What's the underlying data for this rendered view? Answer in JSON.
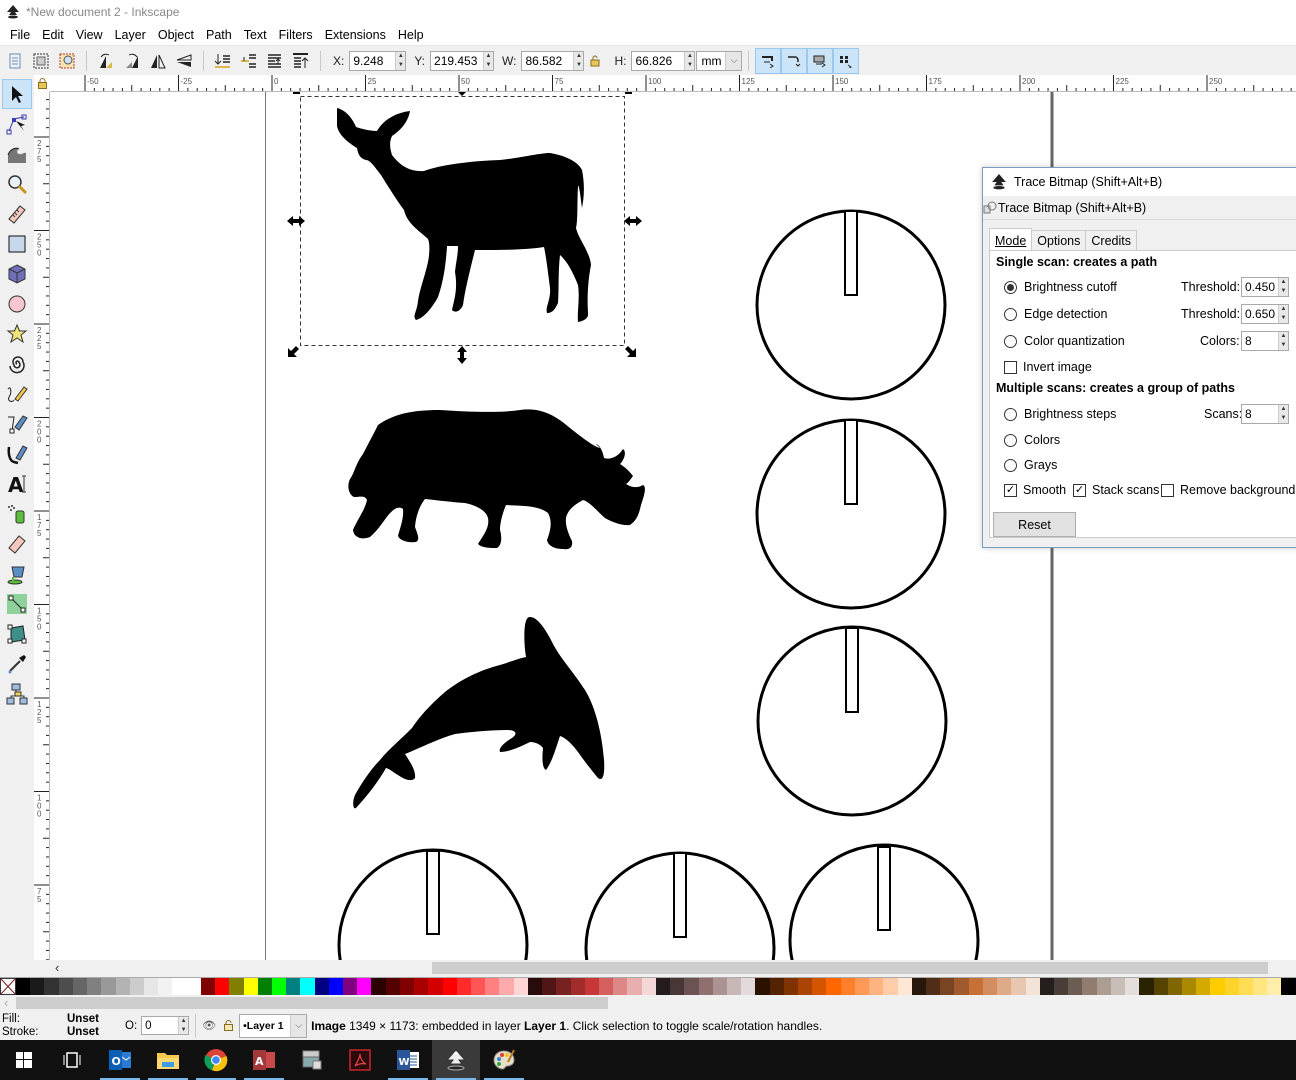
{
  "window": {
    "title": "*New document 2 - Inkscape"
  },
  "menu": [
    "File",
    "Edit",
    "View",
    "Layer",
    "Object",
    "Path",
    "Text",
    "Filters",
    "Extensions",
    "Help"
  ],
  "toolbar": {
    "x_label": "X:",
    "x_value": "9.248",
    "y_label": "Y:",
    "y_value": "219.453",
    "w_label": "W:",
    "w_value": "86.582",
    "h_label": "H:",
    "h_value": "66.826",
    "unit": "mm"
  },
  "rulers": {
    "horizontal": [
      "-50",
      "-25",
      "0",
      "25",
      "50",
      "75",
      "100",
      "125",
      "150",
      "175",
      "200",
      "225",
      "250"
    ],
    "vertical": [
      "275",
      "250",
      "225",
      "200",
      "175",
      "150",
      "125",
      "100",
      "75"
    ]
  },
  "tools": [
    "selector",
    "node",
    "tweak",
    "zoom",
    "measure",
    "rectangle",
    "3d-box",
    "ellipse",
    "star",
    "spiral",
    "pencil",
    "pen",
    "calligraphy",
    "text",
    "spray",
    "eraser",
    "paint-bucket",
    "gradient",
    "mesh",
    "dropper",
    "connector"
  ],
  "canvas": {
    "objects": [
      "deer-silhouette",
      "rhino-silhouette",
      "dolphin-silhouette",
      "dial-circle",
      "dial-circle",
      "dial-circle",
      "dial-circle",
      "dial-circle",
      "dial-circle"
    ]
  },
  "dialog": {
    "title": "Trace Bitmap (Shift+Alt+B)",
    "subtitle": "Trace Bitmap (Shift+Alt+B)",
    "tabs": [
      "Mode",
      "Options",
      "Credits"
    ],
    "active_tab": "Mode",
    "single_heading": "Single scan: creates a path",
    "brightness_label": "Brightness cutoff",
    "brightness_threshold_label": "Threshold:",
    "brightness_threshold": "0.450",
    "edge_label": "Edge detection",
    "edge_threshold_label": "Threshold:",
    "edge_threshold": "0.650",
    "color_q_label": "Color quantization",
    "colors_label": "Colors:",
    "colors_value": "8",
    "invert_label": "Invert image",
    "multi_heading": "Multiple scans: creates a group of paths",
    "bsteps_label": "Brightness steps",
    "scans_label": "Scans:",
    "scans_value": "8",
    "colors_opt_label": "Colors",
    "grays_label": "Grays",
    "smooth_label": "Smooth",
    "stack_label": "Stack scans",
    "remove_bg_label": "Remove background",
    "reset_label": "Reset",
    "selected_mode": "Brightness cutoff",
    "smooth_checked": true,
    "stack_checked": true,
    "invert_checked": false,
    "remove_bg_checked": false
  },
  "palette": [
    "none",
    "#000000",
    "#1a1a1a",
    "#333333",
    "#4d4d4d",
    "#666666",
    "#808080",
    "#999999",
    "#b3b3b3",
    "#cccccc",
    "#e6e6e6",
    "#f2f2f2",
    "#ffffff",
    "#ffffff",
    "#800000",
    "#ff0000",
    "#808000",
    "#ffff00",
    "#008000",
    "#00ff00",
    "#008080",
    "#00ffff",
    "#000080",
    "#0000ff",
    "#800080",
    "#ff00ff",
    "#2b0000",
    "#550000",
    "#800000",
    "#aa0000",
    "#d40000",
    "#ff0000",
    "#ff2a2a",
    "#ff5555",
    "#ff8080",
    "#ffaaaa",
    "#ffd5d5",
    "#280b0b",
    "#501616",
    "#782121",
    "#a02c2c",
    "#c83737",
    "#d35f5f",
    "#de8787",
    "#e9afaf",
    "#f4d7d7",
    "#241c1c",
    "#483737",
    "#6c5353",
    "#916f6f",
    "#ac9393",
    "#c8b7b7",
    "#e3dbdb",
    "#2b1100",
    "#552200",
    "#803300",
    "#aa4400",
    "#d45500",
    "#ff6600",
    "#ff7f2a",
    "#ff9955",
    "#ffb380",
    "#ffccaa",
    "#ffe6d5",
    "#28170b",
    "#502d16",
    "#784421",
    "#a05a2c",
    "#c87137",
    "#d38d5f",
    "#deaa87",
    "#e9c6af",
    "#f4e3d7",
    "#241f1c",
    "#483e37",
    "#6c5d53",
    "#917c6f",
    "#ac9d93",
    "#c8beb7",
    "#e3dedb",
    "#2b2200",
    "#554400",
    "#806600",
    "#aa8800",
    "#d4aa00",
    "#ffcc00",
    "#ffd42a",
    "#ffdd55",
    "#ffe680",
    "#ffeeaa",
    "#000000"
  ],
  "status": {
    "fill_label": "Fill:",
    "fill_value": "Unset",
    "stroke_label": "Stroke:",
    "stroke_value": "Unset",
    "opacity_label": "O:",
    "opacity_value": "0",
    "layer": "•Layer 1",
    "message_bold": "Image",
    "message": " 1349 × 1173: embedded in layer ",
    "message_layer": "Layer 1",
    "message_end": ". Click selection to toggle scale/rotation handles."
  },
  "taskbar": [
    "start",
    "task-view",
    "outlook",
    "file-explorer",
    "chrome",
    "access",
    "scanner",
    "acrobat",
    "word",
    "inkscape",
    "paint"
  ]
}
